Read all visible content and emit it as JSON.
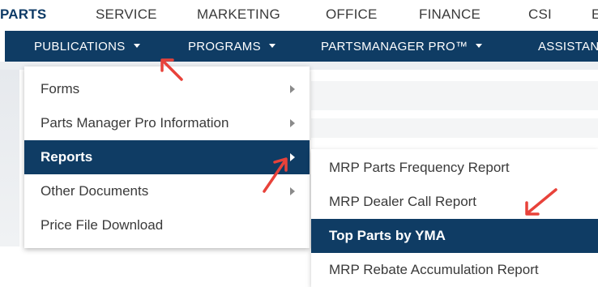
{
  "top_nav": {
    "items": [
      "PARTS",
      "SERVICE",
      "MARKETING",
      "OFFICE",
      "FINANCE",
      "CSI",
      "E"
    ],
    "active": "PARTS"
  },
  "sub_nav": {
    "items": [
      "PUBLICATIONS",
      "PROGRAMS",
      "PARTSMANAGER PRO™",
      "ASSISTAN"
    ]
  },
  "publications_menu": {
    "items": [
      "Forms",
      "Parts Manager Pro Information",
      "Reports",
      "Other Documents",
      "Price File Download"
    ],
    "active": "Reports"
  },
  "reports_submenu": {
    "items": [
      "MRP Parts Frequency Report",
      "MRP Dealer Call Report",
      "Top Parts by YMA",
      "MRP Rebate Accumulation Report"
    ],
    "active": "Top Parts by YMA"
  },
  "colors": {
    "nav_blue": "#0f3c64",
    "annotation_arrow": "#e8423a"
  },
  "icons": {
    "caret": "caret-down-icon",
    "submenu": "triangle-right-icon",
    "annotation": "red-arrow-icon"
  }
}
